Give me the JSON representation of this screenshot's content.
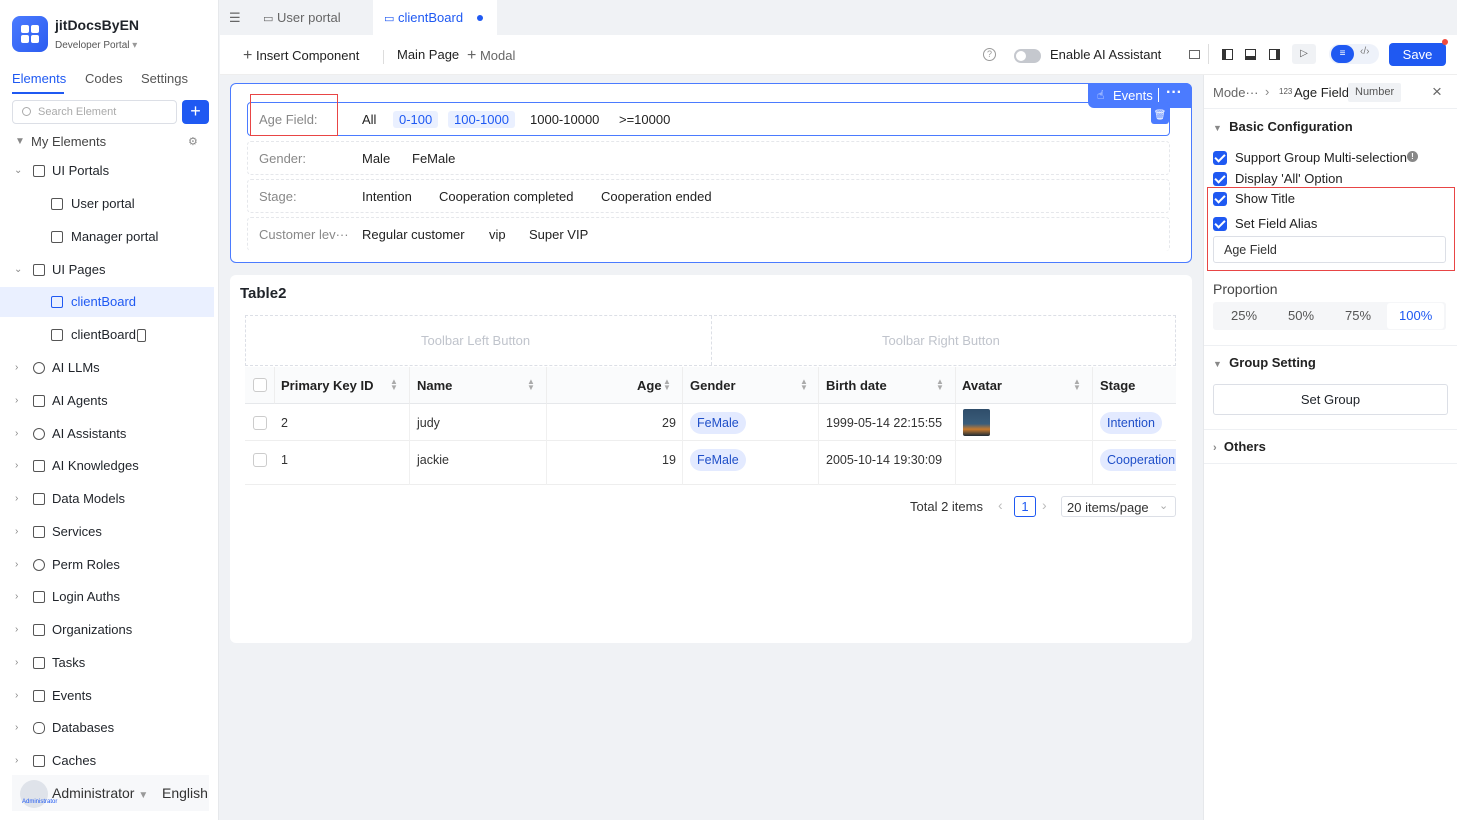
{
  "app": {
    "name": "jitDocsByEN",
    "sub": "Developer Portal"
  },
  "sidebar": {
    "tabs": [
      "Elements",
      "Codes",
      "Settings"
    ],
    "search_placeholder": "Search Element",
    "add_label": "+",
    "tree": [
      {
        "label": "My Elements"
      },
      {
        "label": "UI Portals"
      },
      {
        "label": "User portal"
      },
      {
        "label": "Manager portal"
      },
      {
        "label": "UI Pages"
      },
      {
        "label": "clientBoard"
      },
      {
        "label": "clientBoard"
      },
      {
        "label": "AI LLMs"
      },
      {
        "label": "AI Agents"
      },
      {
        "label": "AI Assistants"
      },
      {
        "label": "AI Knowledges"
      },
      {
        "label": "Data Models"
      },
      {
        "label": "Services"
      },
      {
        "label": "Perm Roles"
      },
      {
        "label": "Login Auths"
      },
      {
        "label": "Organizations"
      },
      {
        "label": "Tasks"
      },
      {
        "label": "Events"
      },
      {
        "label": "Databases"
      },
      {
        "label": "Caches"
      }
    ],
    "user": {
      "name": "Administrator",
      "avatar_text": "Administrator",
      "language": "English"
    }
  },
  "tabs": [
    {
      "label": "User portal"
    },
    {
      "label": "clientBoard"
    }
  ],
  "toolbar": {
    "insert": "Insert Component",
    "main_page": "Main Page",
    "modal": "Modal",
    "ai_assistant": "Enable AI Assistant",
    "save": "Save"
  },
  "filter": {
    "events": "Events",
    "more": "···",
    "rows": [
      {
        "label": "Age Field:",
        "options": [
          "All",
          "0-100",
          "100-1000",
          "1000-10000",
          ">=10000"
        ]
      },
      {
        "label": "Gender:",
        "options": [
          "Male",
          "FeMale"
        ]
      },
      {
        "label": "Stage:",
        "options": [
          "Intention",
          "Cooperation completed",
          "Cooperation ended"
        ]
      },
      {
        "label": "Customer lev···",
        "options": [
          "Regular customer",
          "vip",
          "Super VIP"
        ]
      }
    ]
  },
  "table": {
    "title": "Table2",
    "toolbar_left": "Toolbar Left Button",
    "toolbar_right": "Toolbar Right Button",
    "columns": [
      "Primary Key ID",
      "Name",
      "Age",
      "Gender",
      "Birth date",
      "Avatar",
      "Stage"
    ],
    "rows": [
      {
        "id": "2",
        "name": "judy",
        "age": "29",
        "gender": "FeMale",
        "birth": "1999-05-14 22:15:55",
        "stage": "Intention"
      },
      {
        "id": "1",
        "name": "jackie",
        "age": "19",
        "gender": "FeMale",
        "birth": "2005-10-14 19:30:09",
        "stage": "Cooperation"
      }
    ],
    "total": "Total 2 items",
    "page": "1",
    "page_size": "20 items/page"
  },
  "panel": {
    "breadcrumb_parent": "Mode···",
    "field_name": "Age Field",
    "field_type": "Number",
    "basic": "Basic Configuration",
    "opt_multi": "Support Group Multi-selection",
    "opt_all": "Display 'All' Option",
    "opt_title": "Show Title",
    "opt_alias": "Set Field Alias",
    "alias_value": "Age Field",
    "proportion": "Proportion",
    "proportions": [
      "25%",
      "50%",
      "75%",
      "100%"
    ],
    "group": "Group Setting",
    "set_group": "Set Group",
    "others": "Others"
  },
  "colors": {
    "accent": "#1f59f2",
    "highlight": "#e84545"
  }
}
